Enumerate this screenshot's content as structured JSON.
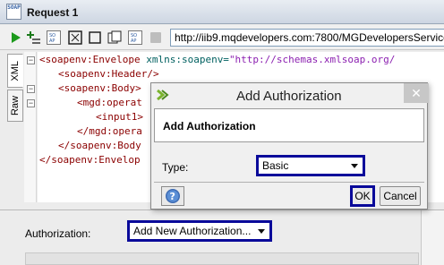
{
  "window": {
    "badge": "SOAP",
    "title": "Request 1"
  },
  "toolbar": {
    "url": "http://iib9.mqdevelopers.com:7800/MGDevelopersService",
    "icons": [
      "play-icon",
      "add-step-icon",
      "soap-icon",
      "fit-icon",
      "square-icon",
      "copy-icon",
      "soap-icon",
      "stop-icon"
    ]
  },
  "editor": {
    "tabs": [
      "XML",
      "Raw"
    ],
    "lines": [
      {
        "tag": "<soapenv:Envelope ",
        "attr": "xmlns:soapenv=",
        "val": "\"http://schemas.xmlsoap.org/"
      },
      {
        "tag": "<soapenv:Header/>"
      },
      {
        "tag": "<soapenv:Body>"
      },
      {
        "tag": "<mgd:operat"
      },
      {
        "tag": "<input1>"
      },
      {
        "tag": "</mgd:opera"
      },
      {
        "tag": "</soapenv:Body"
      },
      {
        "tag": "</soapenv:Envelop"
      }
    ]
  },
  "bottom": {
    "auth_label": "Authorization:",
    "auth_value": "Add New Authorization..."
  },
  "dialog": {
    "title": "Add Authorization",
    "close": "✕",
    "header": "Add Authorization",
    "type_label": "Type:",
    "type_value": "Basic",
    "ok": "OK",
    "cancel": "Cancel"
  },
  "colors": {
    "highlight_border": "#0a0a9a",
    "xml_tag": "#8b0000",
    "xml_attr": "#006060",
    "xml_value": "#8b1fb0"
  }
}
